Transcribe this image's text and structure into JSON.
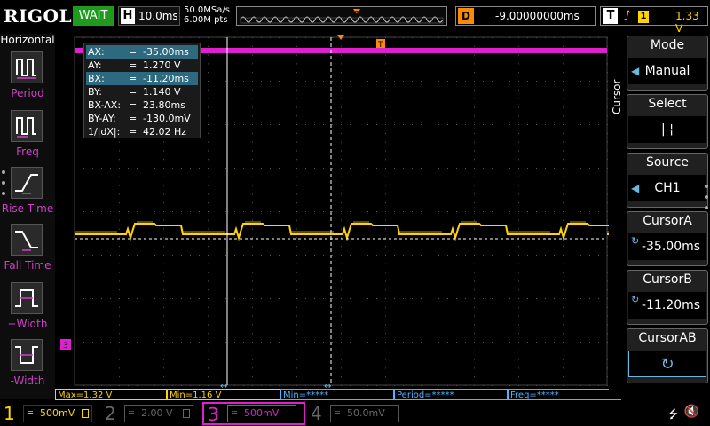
{
  "brand": {
    "logo": "RIGOL"
  },
  "topbar": {
    "status": "WAIT",
    "timebase_key": "H",
    "timebase": "10.0ms",
    "sample_rate": "50.0MSa/s",
    "memory_depth": "6.00M pts",
    "delay_key": "D",
    "delay": "-9.00000000ms",
    "trigger_key": "T",
    "trigger_source": "1",
    "trigger_level": "1.33 V"
  },
  "left_menu": {
    "title": "Horizontal",
    "items": [
      {
        "label": "Period",
        "icon": "period-icon"
      },
      {
        "label": "Freq",
        "icon": "freq-icon"
      },
      {
        "label": "Rise Time",
        "icon": "rise-time-icon"
      },
      {
        "label": "Fall Time",
        "icon": "fall-time-icon"
      },
      {
        "label": "+Width",
        "icon": "positive-width-icon"
      },
      {
        "label": "-Width",
        "icon": "negative-width-icon"
      }
    ]
  },
  "cursor_readout": {
    "rows": [
      {
        "key": "AX:",
        "eq": "=",
        "value": "-35.00ms",
        "selected": true
      },
      {
        "key": "AY:",
        "eq": "=",
        "value": "1.270 V",
        "selected": false
      },
      {
        "key": "BX:",
        "eq": "=",
        "value": "-11.20ms",
        "selected": true
      },
      {
        "key": "BY:",
        "eq": "=",
        "value": "1.140 V",
        "selected": false
      },
      {
        "key": "BX-AX:",
        "eq": "=",
        "value": "23.80ms",
        "selected": false
      },
      {
        "key": "BY-AY:",
        "eq": "=",
        "value": "-130.0mV",
        "selected": false
      },
      {
        "key": "1/|dX|:",
        "eq": "=",
        "value": "42.02 Hz",
        "selected": false
      }
    ]
  },
  "markers": {
    "trigger_pos": "T",
    "trigger_level": "T",
    "ch3_marker": "3"
  },
  "measurements": [
    {
      "label": "Max=1.32 V",
      "color": "#ffd400"
    },
    {
      "label": "Min=1.16 V",
      "color": "#ffd400"
    },
    {
      "label": "Min=*****",
      "color": "#4fb3ff"
    },
    {
      "label": "Period=*****",
      "color": "#4fb3ff"
    },
    {
      "label": "Freq=*****",
      "color": "#4fb3ff"
    }
  ],
  "right_menu": {
    "side_label": "Cursor",
    "mode": {
      "title": "Mode",
      "value": "Manual"
    },
    "select": {
      "title": "Select",
      "value": "|   ¦"
    },
    "source": {
      "title": "Source",
      "value": "CH1"
    },
    "cursor_a": {
      "title": "CursorA",
      "value": "-35.00ms"
    },
    "cursor_b": {
      "title": "CursorB",
      "value": "-11.20ms"
    },
    "cursor_ab": {
      "title": "CursorAB"
    }
  },
  "channels": [
    {
      "num": "1",
      "scale": "500mV",
      "color": "#ffd400",
      "active": true
    },
    {
      "num": "2",
      "scale": "2.00 V",
      "color": "#555555",
      "active": false
    },
    {
      "num": "3",
      "scale": "500mV",
      "color": "#e020d0",
      "active": true
    },
    {
      "num": "4",
      "scale": "50.0mV",
      "color": "#555555",
      "active": false
    }
  ],
  "colors": {
    "ch1": "#ffd400",
    "ch3": "#e020d0",
    "accent": "#2d6a80",
    "trigger": "#ff8a00"
  }
}
